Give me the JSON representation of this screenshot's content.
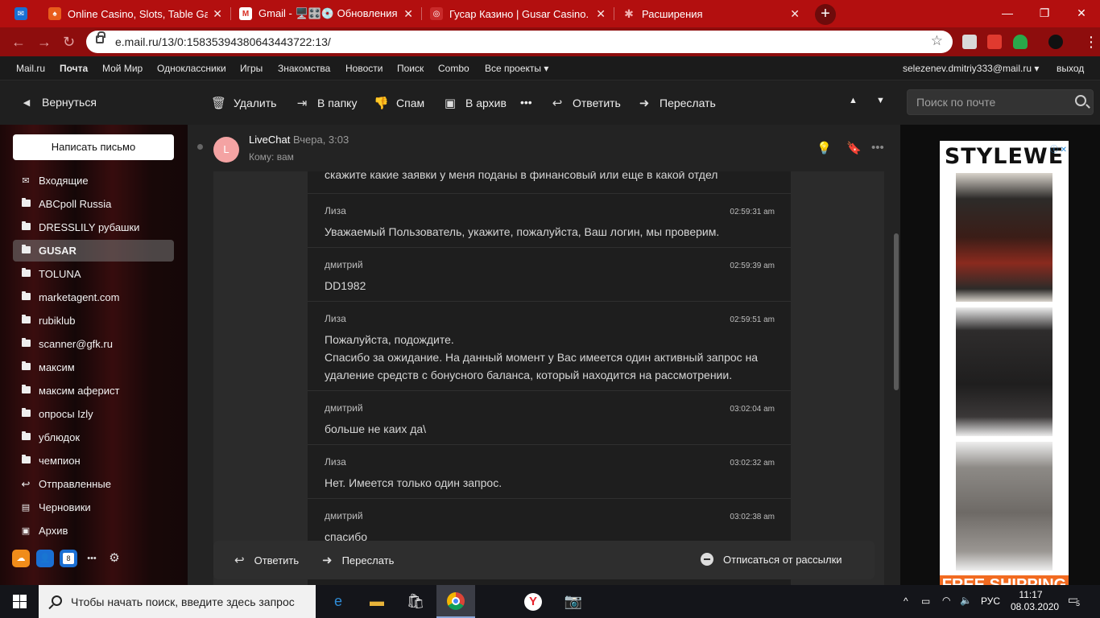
{
  "browser": {
    "tabs": [
      {
        "title": "Online Casino, Slots, Table Games",
        "fav_color": "#e85c1c",
        "fav_glyph": "♠"
      },
      {
        "title": "Gmail - 🖥️🎛️💿 Обновления на",
        "fav_color": "#ffffff",
        "fav_glyph": "M"
      },
      {
        "title": "Гусар Казино | Gusar Casino. Об",
        "fav_color": "#c92a2a",
        "fav_glyph": "◎"
      },
      {
        "title": "Расширения",
        "fav_color": "#c92a2a",
        "fav_glyph": "✱"
      }
    ],
    "url": "e.mail.ru/13/0:15835394380643443722:13/"
  },
  "portal": {
    "links": [
      "Mail.ru",
      "Почта",
      "Мой Мир",
      "Одноклассники",
      "Игры",
      "Знакомства",
      "Новости",
      "Поиск",
      "Combo",
      "Все проекты ▾"
    ],
    "user": "selezenev.dmitriy333@mail.ru ▾",
    "logout": "выход"
  },
  "mailbar": {
    "back": "Вернуться",
    "delete": "Удалить",
    "to_folder": "В папку",
    "spam": "Спам",
    "archive": "В архив",
    "more": "•••",
    "reply": "Ответить",
    "forward": "Переслать",
    "search_placeholder": "Поиск по почте"
  },
  "sidebar": {
    "compose": "Написать письмо",
    "folders": [
      {
        "label": "Входящие",
        "icon": "inbox-icon"
      },
      {
        "label": "ABCpoll Russia",
        "icon": "folder-icon"
      },
      {
        "label": "DRESSLILY рубашки",
        "icon": "folder-icon"
      },
      {
        "label": "GUSAR",
        "icon": "folder-icon",
        "selected": true
      },
      {
        "label": "TOLUNA",
        "icon": "folder-icon"
      },
      {
        "label": "marketagent.com",
        "icon": "folder-icon"
      },
      {
        "label": "rubiklub",
        "icon": "folder-icon"
      },
      {
        "label": "scanner@gfk.ru",
        "icon": "folder-icon"
      },
      {
        "label": "максим",
        "icon": "folder-icon"
      },
      {
        "label": "максим аферист",
        "icon": "folder-icon"
      },
      {
        "label": "опросы Izly",
        "icon": "folder-icon"
      },
      {
        "label": "ублюдок",
        "icon": "folder-icon"
      },
      {
        "label": "чемпион",
        "icon": "folder-icon"
      },
      {
        "label": "Отправленные",
        "icon": "sent-icon"
      },
      {
        "label": "Черновики",
        "icon": "drafts-icon"
      },
      {
        "label": "Архив",
        "icon": "archive-icon"
      }
    ],
    "calendar_day": "8"
  },
  "message": {
    "avatar_letter": "L",
    "sender": "LiveChat",
    "date": "Вчера, 3:03",
    "to": "Кому: вам",
    "top_line": "скажите какие заявки у меня поданы в финансовый или еще в какой отдел",
    "entries": [
      {
        "who": "Лиза",
        "time": "02:59:31 am",
        "text": "Уважаемый Пользователь, укажите, пожалуйста, Ваш логин, мы проверим."
      },
      {
        "who": "дмитрий",
        "time": "02:59:39 am",
        "text": "DD1982"
      },
      {
        "who": "Лиза",
        "time": "02:59:51 am",
        "text": "Пожалуйста, подождите.\nСпасибо за ожидание. На данный момент у Вас имеется один активный запрос на удаление средств с бонусного баланса, который находится на рассмотрении."
      },
      {
        "who": "дмитрий",
        "time": "03:02:04 am",
        "text": "больше не каих да\\"
      },
      {
        "who": "Лиза",
        "time": "03:02:32 am",
        "text": "Нет. Имеется только один запрос."
      },
      {
        "who": "дмитрий",
        "time": "03:02:38 am",
        "text": "спасибо"
      }
    ]
  },
  "footer": {
    "reply": "Ответить",
    "forward": "Переслать",
    "unsubscribe": "Отписаться от рассылки"
  },
  "ad": {
    "brand": "STYLEWE",
    "banner": "FREE SHIPPING"
  },
  "taskbar": {
    "search_placeholder": "Чтобы начать поиск, введите здесь запрос",
    "lang": "РУС",
    "time": "11:17",
    "date": "08.03.2020",
    "notifications": "5"
  }
}
